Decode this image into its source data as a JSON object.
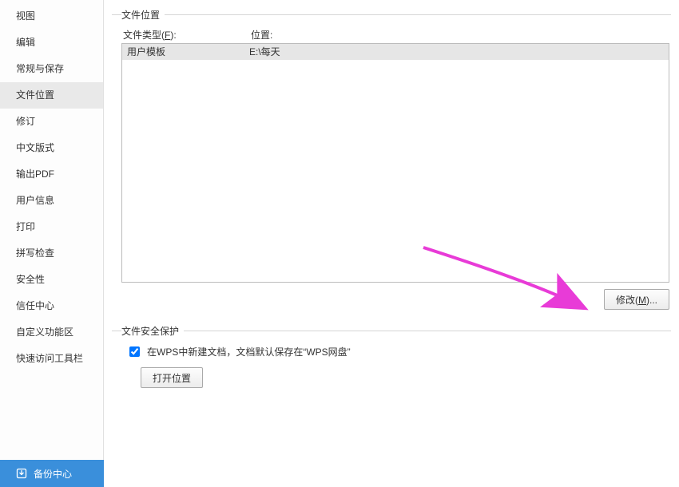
{
  "sidebar": {
    "items": [
      {
        "label": "视图"
      },
      {
        "label": "编辑"
      },
      {
        "label": "常规与保存"
      },
      {
        "label": "文件位置",
        "active": true
      },
      {
        "label": "修订"
      },
      {
        "label": "中文版式"
      },
      {
        "label": "输出PDF"
      },
      {
        "label": "用户信息"
      },
      {
        "label": "打印"
      },
      {
        "label": "拼写检查"
      },
      {
        "label": "安全性"
      },
      {
        "label": "信任中心"
      },
      {
        "label": "自定义功能区"
      },
      {
        "label": "快速访问工具栏"
      }
    ],
    "backup_label": "备份中心"
  },
  "file_location": {
    "group_title": "文件位置",
    "col_type_prefix": "文件类型(",
    "col_type_ul": "F",
    "col_type_suffix": "):",
    "col_loc": "位置:",
    "rows": [
      {
        "type": "用户模板",
        "loc": "E:\\每天"
      }
    ],
    "modify_prefix": "修改(",
    "modify_ul": "M",
    "modify_suffix": ")..."
  },
  "file_safety": {
    "group_title": "文件安全保护",
    "checkbox_label": "在WPS中新建文档，文档默认保存在“WPS网盘”",
    "checkbox_checked": true,
    "open_location_label": "打开位置"
  }
}
